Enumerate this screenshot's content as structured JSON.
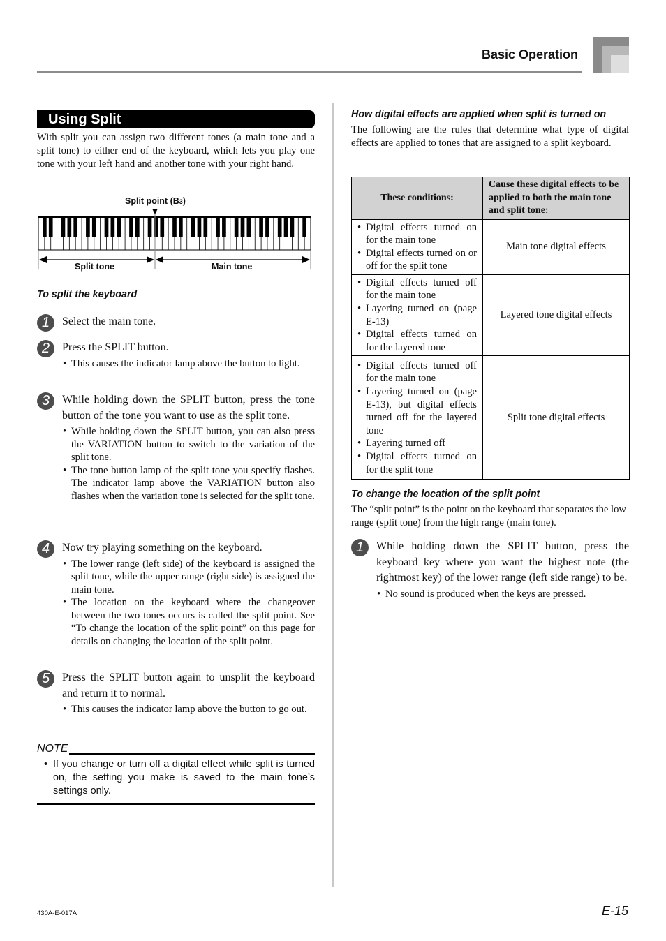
{
  "header": {
    "section_title": "Basic Operation"
  },
  "left": {
    "title": "Using Split",
    "intro": "With split you can assign two different tones (a main tone and a split tone) to either end of the keyboard, which lets you play one tone with your left hand and another tone with your right hand.",
    "figure": {
      "split_point_label": "Split point (B",
      "split_point_sub": "3",
      "split_point_close": ")",
      "left_label": "Split tone",
      "right_label": "Main tone"
    },
    "procedure_title": "To split the keyboard",
    "steps": [
      {
        "number": "1",
        "text": "Select the main tone.",
        "bullets": []
      },
      {
        "number": "2",
        "text": "Press the SPLIT button.",
        "bullets": [
          "This causes the indicator lamp above the button to light."
        ]
      },
      {
        "number": "3",
        "text": "While holding down the SPLIT button, press the tone button of the tone you want to use as the split tone.",
        "bullets": [
          "While holding down the SPLIT button, you can also press the VARIATION button to switch to the variation of the split tone.",
          "The tone button lamp of the split tone you specify flashes. The indicator lamp above the VARIATION button also flashes when the variation tone is selected for the split tone."
        ]
      },
      {
        "number": "4",
        "text": "Now try playing something on the keyboard.",
        "bullets": [
          "The lower range (left side) of the keyboard is assigned the split tone, while the upper range (right side) is assigned the main tone.",
          "The location on the keyboard where the changeover between the two tones occurs is called the split point. See “To change the location of the split point” on this page for details on changing the location of the split point."
        ]
      },
      {
        "number": "5",
        "text": "Press the SPLIT button again to unsplit the keyboard and return it to normal.",
        "bullets": [
          "This causes the indicator lamp above the button to go out."
        ]
      }
    ],
    "note": {
      "heading": "NOTE",
      "text": "If you change or turn off a digital effect while split is turned on, the setting you make is saved to the main tone’s settings only."
    }
  },
  "right": {
    "effects_title": "How digital effects are applied when split is turned on",
    "effects_intro": "The following are the rules that determine what type of digital effects are applied to tones that are assigned to a split keyboard.",
    "table": {
      "headers": [
        "These conditions:",
        "Cause these digital effects to be applied to both the main tone and split tone:"
      ],
      "rows": [
        {
          "conditions": [
            "Digital effects turned on for the main tone",
            "Digital effects turned on or off for the split tone"
          ],
          "effect": "Main tone digital effects"
        },
        {
          "conditions": [
            "Digital effects turned off for the main tone",
            "Layering turned on (page E-13)",
            "Digital effects turned on for the layered tone"
          ],
          "effect": "Layered tone digital effects"
        },
        {
          "conditions": [
            "Digital effects turned off for the main tone",
            "Layering turned on (page E-13), but digital effects turned off for the layered tone",
            "Layering turned off",
            "Digital effects turned on for the split tone"
          ],
          "effect": "Split tone digital effects"
        }
      ]
    },
    "change_title": "To change the location of the split point",
    "change_intro": "The “split point” is the point on the keyboard that separates the low range (split tone) from the high range (main tone).",
    "change_step": {
      "number": "1",
      "text": "While holding down the SPLIT button, press the keyboard key where you want the highest note (the rightmost key) of the lower range (left side range) to be.",
      "bullets": [
        "No sound is produced when the keys are pressed."
      ]
    }
  },
  "footer": {
    "code": "430A-E-017A",
    "page": "E-15"
  }
}
